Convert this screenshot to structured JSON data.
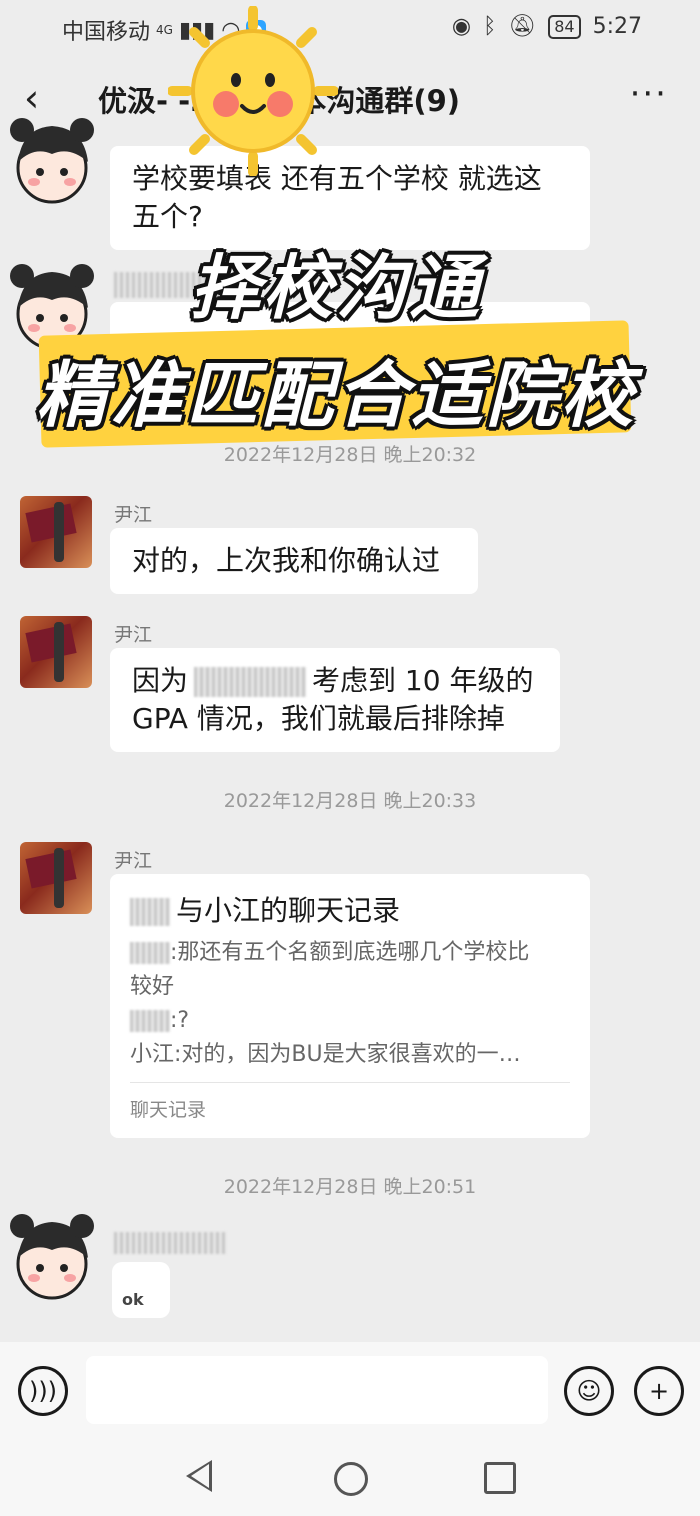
{
  "status_bar": {
    "carrier": "中国移动",
    "network": "4G",
    "battery": "84",
    "time": "5:27"
  },
  "header": {
    "title": "优汲-              -2…本美本沟通群(9)"
  },
  "messages": {
    "first_bubble": "学校要填表 还有五个学校 就选这五个?",
    "ts1": "2022年12月28日 晚上20:32",
    "sender1": "尹江",
    "msg1": "对的，上次我和你确认过",
    "sender2": "尹江",
    "msg2_prefix": "因为",
    "msg2_suffix": "考虑到 10 年级的",
    "msg2_line2": "GPA 情况，我们就最后排除掉",
    "ts2": "2022年12月28日 晚上20:33",
    "sender3": "尹江",
    "record_title": "与小江的聊天记录",
    "record_line1": ":那还有五个名额到底选哪几个学校比",
    "record_line1b": "较好",
    "record_line2": ":?",
    "record_line3": "小江:对的，因为BU是大家很喜欢的一…",
    "record_footer": "聊天记录",
    "ts3": "2022年12月28日 晚上20:51",
    "sticker_text": "ok"
  },
  "overlay": {
    "line1": "择校沟通",
    "line2": "精准匹配合适院校"
  }
}
